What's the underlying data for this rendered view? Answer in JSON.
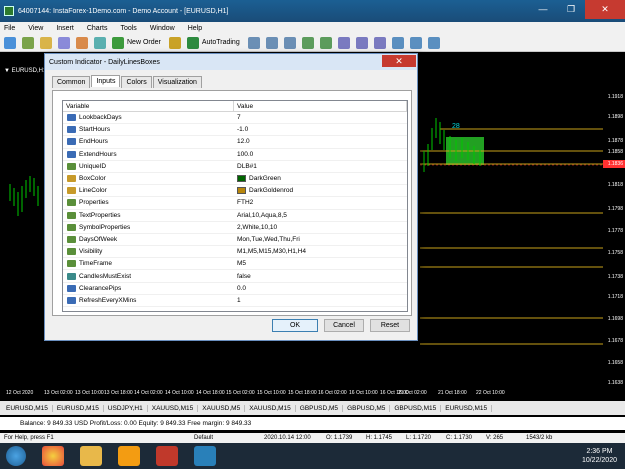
{
  "window": {
    "title": "64007144: InstaForex-1Demo.com - Demo Account - [EURUSD,H1]"
  },
  "menu": [
    "File",
    "View",
    "Insert",
    "Charts",
    "Tools",
    "Window",
    "Help"
  ],
  "toolbar": {
    "new_order": "New Order",
    "autotrading": "AutoTrading"
  },
  "chart": {
    "tab_label": "EURUSD,H1",
    "price_labels": [
      "1.1918",
      "1.1898",
      "1.1878",
      "1.1858",
      "1.1836",
      "1.1818",
      "1.1798",
      "1.1778",
      "1.1758",
      "1.1738",
      "1.1718",
      "1.1698",
      "1.1678",
      "1.1658",
      "1.1638"
    ],
    "current_price": "1.1836",
    "time_labels": [
      "12 Oct 2020",
      "13 Oct 02:00",
      "13 Oct 10:00",
      "13 Oct 18:00",
      "14 Oct 02:00",
      "14 Oct 10:00",
      "14 Oct 18:00",
      "15 Oct 02:00",
      "15 Oct 10:00",
      "15 Oct 18:00",
      "16 Oct 02:00",
      "16 Oct 10:00",
      "16 Oct 18:00",
      "19 Oct 10:00",
      "19 Oct 18:00",
      "20 Oct 02:00",
      "21 Oct 02:00",
      "21 Oct 18:00",
      "22 Oct 10:00"
    ],
    "box_label": "28"
  },
  "dialog": {
    "title": "Custom Indicator - DailyLinesBoxes",
    "close": "✕",
    "tabs": [
      "Common",
      "Inputs",
      "Colors",
      "Visualization"
    ],
    "active_tab": "Inputs",
    "columns": {
      "variable": "Variable",
      "value": "Value"
    },
    "rows": [
      {
        "name": "LookbackDays",
        "value": "7",
        "type": "num"
      },
      {
        "name": "StartHours",
        "value": "-1.0",
        "type": "num"
      },
      {
        "name": "EndHours",
        "value": "12.0",
        "type": "num"
      },
      {
        "name": "ExtendHours",
        "value": "100.0",
        "type": "num"
      },
      {
        "name": "UniqueID",
        "value": "DLB#1",
        "type": "str"
      },
      {
        "name": "BoxColor",
        "value": "DarkGreen",
        "type": "col",
        "color": "#006400"
      },
      {
        "name": "LineColor",
        "value": "DarkGoldenrod",
        "type": "col",
        "color": "#b8860b"
      },
      {
        "name": "Properties",
        "value": "FTH2",
        "type": "str"
      },
      {
        "name": "TextProperties",
        "value": "Arial,10,Aqua,8,5",
        "type": "str"
      },
      {
        "name": "SymbolProperties",
        "value": "2,White,10,10",
        "type": "str"
      },
      {
        "name": "DaysOfWeek",
        "value": "Mon,Tue,Wed,Thu,Fri",
        "type": "str"
      },
      {
        "name": "Visibility",
        "value": "M1,M5,M15,M30,H1,H4",
        "type": "str"
      },
      {
        "name": "TimeFrame",
        "value": "M5",
        "type": "str"
      },
      {
        "name": "CandlesMustExist",
        "value": "false",
        "type": "bool"
      },
      {
        "name": "ClearancePips",
        "value": "0.0",
        "type": "num"
      },
      {
        "name": "RefreshEveryXMins",
        "value": "1",
        "type": "num"
      }
    ],
    "buttons": {
      "ok": "OK",
      "cancel": "Cancel",
      "reset": "Reset"
    }
  },
  "symbol_tabs": [
    "EURUSD,M15",
    "EURUSD,M15",
    "USDJPY,H1",
    "XAUUSD,M15",
    "XAUUSD,M5",
    "XAUUSD,M15",
    "GBPUSD,M5",
    "GBPUSD,M5",
    "GBPUSD,M15",
    "EURUSD,M15"
  ],
  "balance": {
    "text": "Balance: 9 849.33 USD  Profit/Loss: 0.00  Equity: 9 849.33  Free margin: 9 849.33"
  },
  "statusbar": {
    "help": "For Help, press F1",
    "profile": "Default",
    "datetime": "2020.10.14 12:00",
    "open": "O: 1.1739",
    "high": "H: 1.1745",
    "low": "L: 1.1720",
    "close": "C: 1.1730",
    "volume": "V: 265",
    "traffic": "1543/2 kb"
  },
  "taskbar": {
    "time": "2:36 PM",
    "date": "10/22/2020"
  },
  "colors": {
    "box": "#22a022",
    "gold_line": "#c8a21a",
    "bull": "#00c800"
  }
}
